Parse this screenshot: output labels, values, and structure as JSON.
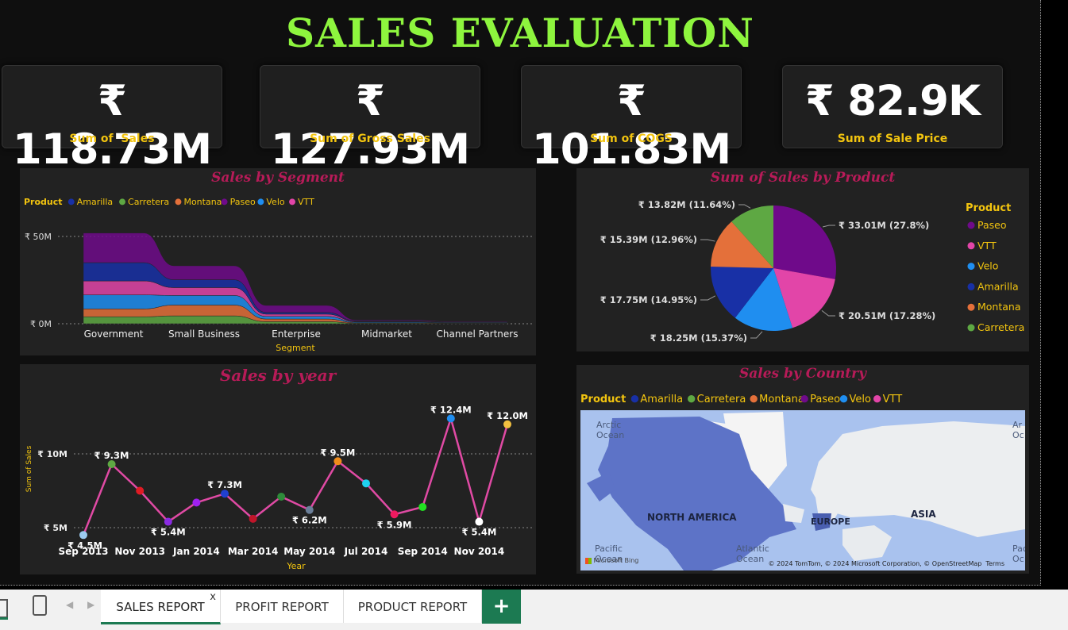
{
  "page_title": "SALES EVALUATION",
  "kpis": [
    {
      "value": "₹ 118.73M",
      "label": "Sum of  Sales"
    },
    {
      "value": "₹ 127.93M",
      "label": "Sum of Gross Sales"
    },
    {
      "value": "₹ 101.83M",
      "label": "Sum of COGS"
    },
    {
      "value": "₹ 82.9K",
      "label": "Sum of Sale Price"
    }
  ],
  "colors": {
    "Amarilla": "#1830a6",
    "Carretera": "#5ea843",
    "Montana": "#e4703a",
    "Paseo": "#6f0a8a",
    "Velo": "#1f8ef0",
    "VTT": "#e245a8",
    "line": "#e04aa4",
    "title_green": "#8ef53e",
    "label_gold": "#f2c40f",
    "panel_title": "#b71b58"
  },
  "chart_data": [
    {
      "type": "area",
      "title": "Sales by Segment",
      "xlabel": "Segment",
      "legend_title": "Product",
      "legend": [
        "Amarilla",
        "Carretera",
        "Montana",
        "Paseo",
        "Velo",
        "VTT"
      ],
      "categories": [
        "Government",
        "Small Business",
        "Enterprise",
        "Midmarket",
        "Channel Partners"
      ],
      "ytick_labels": [
        "₹ 50M",
        "₹ 0M"
      ],
      "ylim": [
        0,
        50
      ],
      "stack_order": [
        "Carretera",
        "Montana",
        "Velo",
        "VTT",
        "Amarilla",
        "Paseo"
      ],
      "series": [
        {
          "name": "Carretera",
          "values": [
            4.0,
            4.5,
            1.2,
            0.3,
            0.2
          ]
        },
        {
          "name": "Montana",
          "values": [
            4.5,
            6.2,
            1.5,
            0.3,
            0.2
          ]
        },
        {
          "name": "Velo",
          "values": [
            8.0,
            5.5,
            1.5,
            0.4,
            0.3
          ]
        },
        {
          "name": "VTT",
          "values": [
            8.0,
            4.5,
            1.3,
            0.3,
            0.2
          ]
        },
        {
          "name": "Amarilla",
          "values": [
            10.5,
            4.5,
            1.0,
            0.3,
            0.2
          ]
        },
        {
          "name": "Paseo",
          "values": [
            17.0,
            8.0,
            4.0,
            0.5,
            0.3
          ]
        }
      ]
    },
    {
      "type": "pie",
      "title": "Sum of Sales by Product",
      "legend_title": "Product",
      "slices": [
        {
          "name": "Paseo",
          "value": 33.01,
          "label": "₹ 33.01M (27.8%)"
        },
        {
          "name": "VTT",
          "value": 20.51,
          "label": "₹ 20.51M (17.28%)"
        },
        {
          "name": "Velo",
          "value": 18.25,
          "label": "₹ 18.25M (15.37%)"
        },
        {
          "name": "Amarilla",
          "value": 17.75,
          "label": "₹ 17.75M (14.95%)"
        },
        {
          "name": "Montana",
          "value": 15.39,
          "label": "₹ 15.39M (12.96%)"
        },
        {
          "name": "Carretera",
          "value": 13.82,
          "label": "₹ 13.82M (11.64%)"
        }
      ]
    },
    {
      "type": "line",
      "title": "Sales by year",
      "xlabel": "Year",
      "ylabel": "Sum of Sales",
      "ylim": [
        4.2,
        13.0
      ],
      "yticks": [
        5,
        10
      ],
      "ytick_labels": [
        "₹ 5M",
        "₹ 10M"
      ],
      "x_tick_labels": [
        "Sep 2013",
        "Nov 2013",
        "Jan 2014",
        "Mar 2014",
        "May 2014",
        "Jul 2014",
        "Sep 2014",
        "Nov 2014"
      ],
      "x_tick_index": [
        0,
        2,
        4,
        6,
        8,
        10,
        12,
        14
      ],
      "points": [
        {
          "x": "Sep 2013",
          "y": 4.5,
          "label": "₹ 4.5M",
          "color": "#9ccbf0"
        },
        {
          "x": "Oct 2013",
          "y": 9.3,
          "label": "₹ 9.3M",
          "color": "#5ea843"
        },
        {
          "x": "Nov 2013",
          "y": 7.5,
          "label": "",
          "color": "#e01b24"
        },
        {
          "x": "Dec 2013",
          "y": 5.4,
          "label": "₹ 5.4M",
          "color": "#8a2be2"
        },
        {
          "x": "Jan 2014",
          "y": 6.7,
          "label": "",
          "color": "#a020f0"
        },
        {
          "x": "Feb 2014",
          "y": 7.3,
          "label": "₹ 7.3M",
          "color": "#2040d0"
        },
        {
          "x": "Mar 2014",
          "y": 5.6,
          "label": "",
          "color": "#c0152a"
        },
        {
          "x": "Apr 2014",
          "y": 7.1,
          "label": "",
          "color": "#2e8b3a"
        },
        {
          "x": "May 2014",
          "y": 6.2,
          "label": "₹ 6.2M",
          "color": "#6b7f99"
        },
        {
          "x": "Jun 2014",
          "y": 9.5,
          "label": "₹ 9.5M",
          "color": "#f08c1a"
        },
        {
          "x": "Jul 2014",
          "y": 8.0,
          "label": "",
          "color": "#1fd0f0"
        },
        {
          "x": "Aug 2014",
          "y": 5.9,
          "label": "₹ 5.9M",
          "color": "#f01a60"
        },
        {
          "x": "Sep 2014",
          "y": 6.4,
          "label": "",
          "color": "#22e022"
        },
        {
          "x": "Oct 2014",
          "y": 12.4,
          "label": "₹ 12.4M",
          "color": "#1f8ef0"
        },
        {
          "x": "Nov 2014",
          "y": 5.4,
          "label": "₹ 5.4M",
          "color": "#ffffff"
        },
        {
          "x": "Dec 2014",
          "y": 12.0,
          "label": "₹ 12.0M",
          "color": "#f2c040"
        }
      ]
    }
  ],
  "country_map": {
    "title": "Sales by Country",
    "legend_title": "Product",
    "legend": [
      "Amarilla",
      "Carretera",
      "Montana",
      "Paseo",
      "Velo",
      "VTT"
    ],
    "labels": {
      "arctic": "Arctic Ocean",
      "arctic2": "Ar Oc",
      "north_america": "NORTH AMERICA",
      "europe": "EUROPE",
      "asia": "ASIA",
      "atlantic": "Atlantic Ocean",
      "pacific": "Pacific Ocean",
      "pacific2": "Pac Oc",
      "credits": "© 2024 TomTom, © 2024 Microsoft Corporation, © OpenStreetMap  Terms",
      "bing": "Microsoft Bing"
    }
  },
  "tabs": [
    {
      "label": "SALES REPORT",
      "active": true,
      "close": "x"
    },
    {
      "label": "PROFIT REPORT",
      "active": false
    },
    {
      "label": "PRODUCT REPORT",
      "active": false
    }
  ],
  "add_tab": "+"
}
